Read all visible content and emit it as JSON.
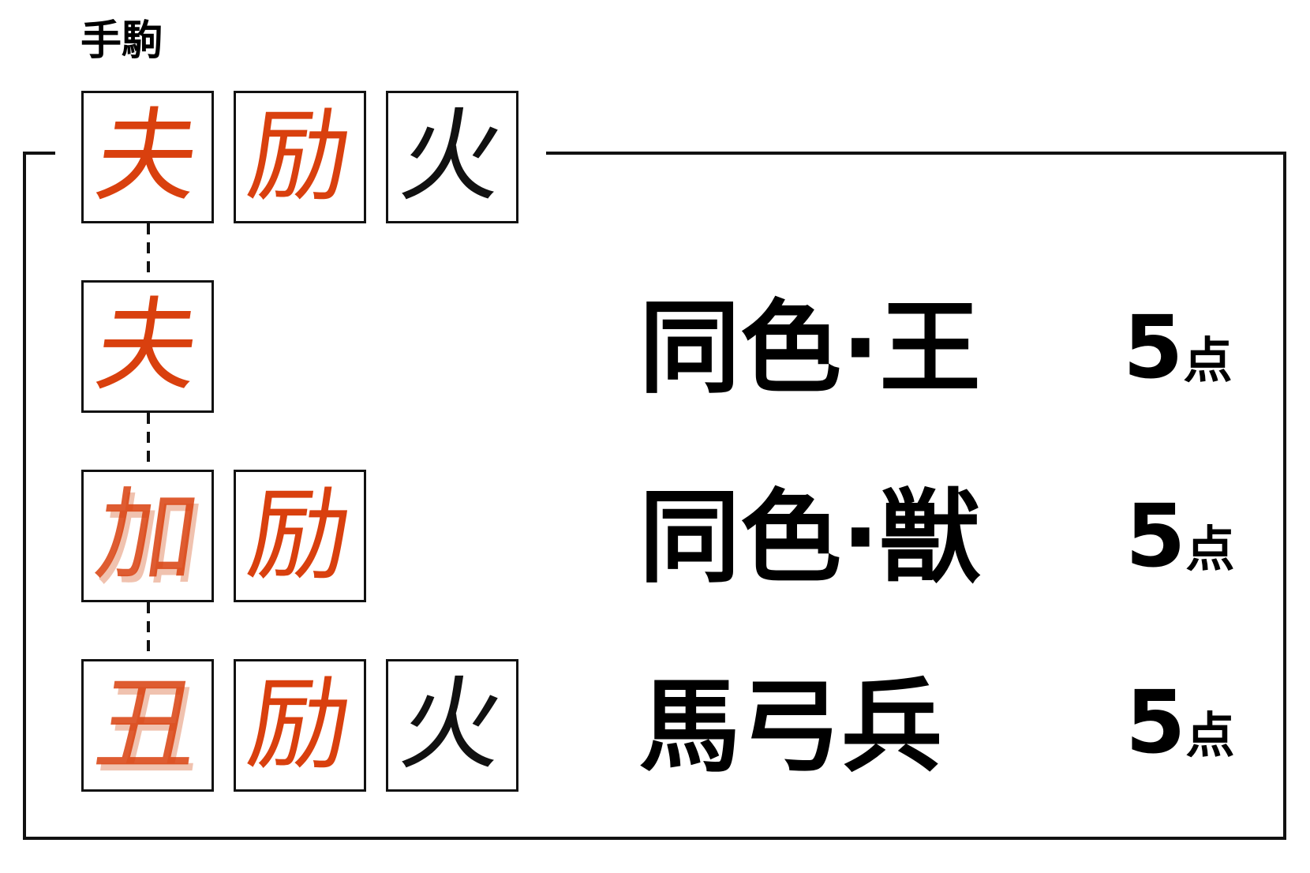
{
  "hand": {
    "label": "手駒",
    "tiles": [
      {
        "char": "夫",
        "color": "red"
      },
      {
        "char": "励",
        "color": "red"
      },
      {
        "char": "火",
        "color": "black"
      }
    ]
  },
  "rows": [
    {
      "tiles": [
        {
          "char": "夫",
          "color": "red",
          "faded": false
        }
      ],
      "combo": "同色·王",
      "score": "5",
      "unit": "点"
    },
    {
      "tiles": [
        {
          "char": "加",
          "color": "red",
          "faded": true
        },
        {
          "char": "励",
          "color": "red",
          "faded": false
        }
      ],
      "combo": "同色·獣",
      "score": "5",
      "unit": "点"
    },
    {
      "tiles": [
        {
          "char": "丑",
          "color": "red",
          "faded": true
        },
        {
          "char": "励",
          "color": "red",
          "faded": false
        },
        {
          "char": "火",
          "color": "black",
          "faded": false
        }
      ],
      "combo": "馬弓兵",
      "score": "5",
      "unit": "点"
    }
  ],
  "colors": {
    "red": "#d9400e",
    "black": "#111111",
    "frame": "#111111"
  }
}
